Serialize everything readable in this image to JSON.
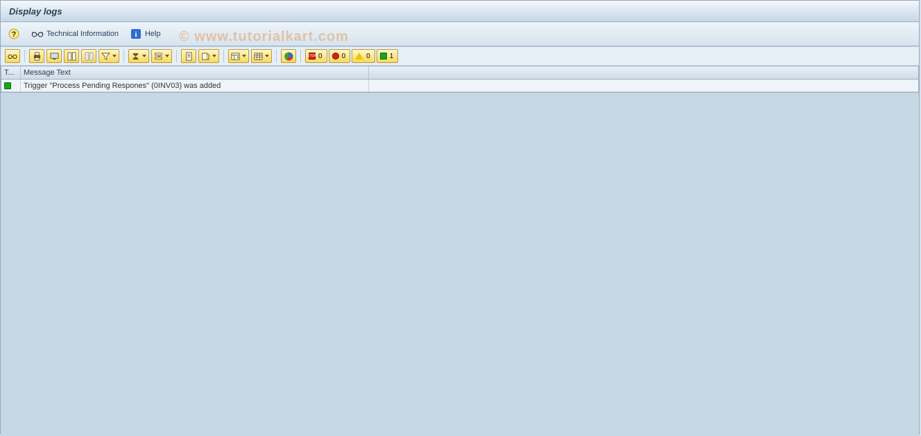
{
  "title": "Display logs",
  "app_toolbar": {
    "tech_info_label": "Technical Information",
    "help_label": "Help"
  },
  "counters": {
    "stop_label": "0",
    "error_label": "0",
    "warn_label": "0",
    "success_label": "1"
  },
  "grid": {
    "columns": {
      "type": "T...",
      "message": "Message Text"
    },
    "rows": [
      {
        "type": "success",
        "message": "Trigger \"Process Pending Respones\" (0INV03) was added"
      }
    ]
  },
  "watermark": "© www.tutorialkart.com"
}
